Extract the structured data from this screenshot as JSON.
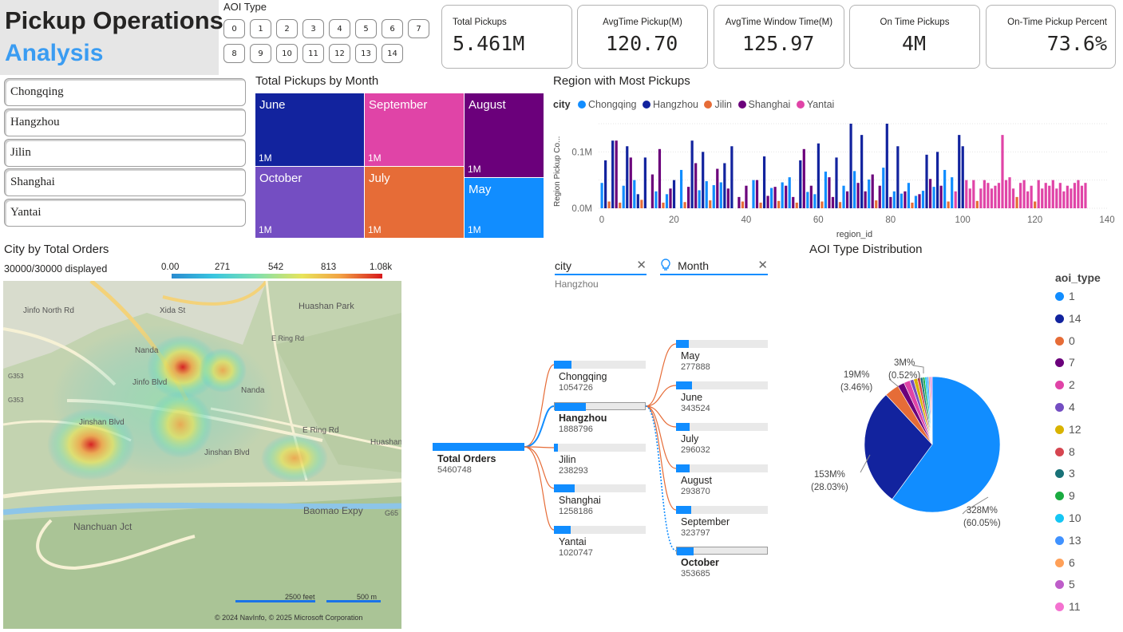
{
  "header": {
    "title_line1": "Pickup Operations",
    "title_line2": "Analysis"
  },
  "aoi_slicer": {
    "title": "AOI Type",
    "chips": [
      "0",
      "1",
      "2",
      "3",
      "4",
      "5",
      "6",
      "7",
      "8",
      "9",
      "10",
      "11",
      "12",
      "13",
      "14"
    ]
  },
  "kpis": [
    {
      "label": "Total Pickups",
      "value": "5.461M"
    },
    {
      "label": "AvgTime Pickup(M)",
      "value": "120.70"
    },
    {
      "label": "AvgTime Window Time(M)",
      "value": "125.97"
    },
    {
      "label": "On Time Pickups",
      "value": "4M"
    },
    {
      "label": "On-Time Pickup Percent",
      "value": "73.6%"
    }
  ],
  "city_slicer": [
    "Chongqing",
    "Hangzhou",
    "Jilin",
    "Shanghai",
    "Yantai"
  ],
  "treemap": {
    "title": "Total Pickups by Month",
    "cells": [
      {
        "name": "June",
        "value": "1M",
        "color": "#12239e"
      },
      {
        "name": "September",
        "value": "1M",
        "color": "#e044a7"
      },
      {
        "name": "August",
        "value": "1M",
        "color": "#6b007b"
      },
      {
        "name": "October",
        "value": "1M",
        "color": "#744ec2"
      },
      {
        "name": "July",
        "value": "1M",
        "color": "#e66c37"
      },
      {
        "name": "May",
        "value": "1M",
        "color": "#118dff"
      }
    ]
  },
  "chart_data": {
    "type": "bar",
    "title": "Region with Most Pickups",
    "xlabel": "region_id",
    "ylabel": "Region Pickup Co...",
    "legend_title": "city",
    "legend_position": "top-left",
    "xlim": [
      0,
      140
    ],
    "ylim": [
      0,
      0.15
    ],
    "xticks": [
      "0",
      "20",
      "40",
      "60",
      "80",
      "100",
      "120",
      "140"
    ],
    "yticks": [
      "0.0M",
      "0.1M"
    ],
    "grid": true,
    "series": [
      {
        "name": "Chongqing",
        "color": "#118dff",
        "points": [
          [
            0,
            0.045
          ],
          [
            6,
            0.04
          ],
          [
            9,
            0.05
          ],
          [
            15,
            0.03
          ],
          [
            18,
            0.025
          ],
          [
            22,
            0.068
          ],
          [
            27,
            0.032
          ],
          [
            29,
            0.048
          ],
          [
            31,
            0.041
          ],
          [
            33,
            0.046
          ],
          [
            42,
            0.05
          ],
          [
            47,
            0.036
          ],
          [
            50,
            0.046
          ],
          [
            52,
            0.055
          ],
          [
            57,
            0.029
          ],
          [
            59,
            0.025
          ],
          [
            62,
            0.065
          ],
          [
            67,
            0.04
          ],
          [
            70,
            0.066
          ],
          [
            72,
            0.048
          ],
          [
            74,
            0.051
          ],
          [
            78,
            0.072
          ],
          [
            81,
            0.03
          ],
          [
            83,
            0.026
          ],
          [
            85,
            0.045
          ],
          [
            87,
            0.022
          ],
          [
            89,
            0.031
          ],
          [
            92,
            0.038
          ],
          [
            95,
            0.068
          ],
          [
            97,
            0.055
          ]
        ]
      },
      {
        "name": "Hangzhou",
        "color": "#12239e",
        "points": [
          [
            1,
            0.085
          ],
          [
            3,
            0.12
          ],
          [
            7,
            0.11
          ],
          [
            10,
            0.025
          ],
          [
            12,
            0.09
          ],
          [
            20,
            0.05
          ],
          [
            25,
            0.12
          ],
          [
            28,
            0.1
          ],
          [
            34,
            0.08
          ],
          [
            36,
            0.11
          ],
          [
            45,
            0.092
          ],
          [
            55,
            0.085
          ],
          [
            60,
            0.115
          ],
          [
            65,
            0.09
          ],
          [
            69,
            0.15
          ],
          [
            72,
            0.13
          ],
          [
            79,
            0.15
          ],
          [
            82,
            0.11
          ],
          [
            90,
            0.095
          ],
          [
            93,
            0.1
          ],
          [
            99,
            0.13
          ],
          [
            100,
            0.11
          ]
        ]
      },
      {
        "name": "Jilin",
        "color": "#e66c37",
        "points": [
          [
            2,
            0.012
          ],
          [
            5,
            0.01
          ],
          [
            11,
            0.015
          ],
          [
            17,
            0.01
          ],
          [
            23,
            0.011
          ],
          [
            30,
            0.014
          ],
          [
            39,
            0.012
          ],
          [
            44,
            0.01
          ],
          [
            49,
            0.013
          ],
          [
            54,
            0.01
          ],
          [
            61,
            0.012
          ],
          [
            66,
            0.011
          ],
          [
            76,
            0.014
          ],
          [
            86,
            0.01
          ],
          [
            96,
            0.012
          ],
          [
            104,
            0.013
          ],
          [
            115,
            0.02
          ],
          [
            120,
            0.012
          ]
        ]
      },
      {
        "name": "Shanghai",
        "color": "#6b007b",
        "points": [
          [
            4,
            0.12
          ],
          [
            8,
            0.09
          ],
          [
            14,
            0.06
          ],
          [
            16,
            0.105
          ],
          [
            19,
            0.035
          ],
          [
            24,
            0.038
          ],
          [
            26,
            0.08
          ],
          [
            32,
            0.07
          ],
          [
            35,
            0.035
          ],
          [
            38,
            0.02
          ],
          [
            40,
            0.04
          ],
          [
            43,
            0.05
          ],
          [
            46,
            0.022
          ],
          [
            48,
            0.038
          ],
          [
            51,
            0.04
          ],
          [
            53,
            0.02
          ],
          [
            56,
            0.105
          ],
          [
            58,
            0.04
          ],
          [
            63,
            0.055
          ],
          [
            64,
            0.02
          ],
          [
            68,
            0.03
          ],
          [
            71,
            0.045
          ],
          [
            73,
            0.03
          ],
          [
            75,
            0.06
          ],
          [
            77,
            0.04
          ],
          [
            80,
            0.02
          ],
          [
            84,
            0.03
          ],
          [
            88,
            0.025
          ],
          [
            91,
            0.052
          ],
          [
            94,
            0.04
          ]
        ]
      },
      {
        "name": "Yantai",
        "color": "#e044a7",
        "points": [
          [
            98,
            0.03
          ],
          [
            101,
            0.05
          ],
          [
            102,
            0.035
          ],
          [
            103,
            0.05
          ],
          [
            105,
            0.035
          ],
          [
            106,
            0.05
          ],
          [
            107,
            0.045
          ],
          [
            108,
            0.035
          ],
          [
            109,
            0.04
          ],
          [
            110,
            0.045
          ],
          [
            111,
            0.13
          ],
          [
            112,
            0.05
          ],
          [
            113,
            0.055
          ],
          [
            114,
            0.035
          ],
          [
            116,
            0.045
          ],
          [
            117,
            0.05
          ],
          [
            118,
            0.03
          ],
          [
            119,
            0.04
          ],
          [
            121,
            0.05
          ],
          [
            122,
            0.035
          ],
          [
            123,
            0.045
          ],
          [
            124,
            0.04
          ],
          [
            125,
            0.05
          ],
          [
            126,
            0.035
          ],
          [
            127,
            0.045
          ],
          [
            128,
            0.03
          ],
          [
            129,
            0.04
          ],
          [
            130,
            0.035
          ],
          [
            131,
            0.045
          ],
          [
            132,
            0.05
          ],
          [
            133,
            0.04
          ],
          [
            134,
            0.045
          ]
        ]
      }
    ]
  },
  "map": {
    "title": "City by Total Orders",
    "displayed": "30000/30000 displayed",
    "scale_ticks": [
      "0.00",
      "271",
      "542",
      "813",
      "1.08k"
    ],
    "labels": [
      "Huashan Park",
      "Xida St",
      "Jinfo North Rd",
      "Nanda",
      "Jinfo Blvd",
      "Jinshan Blvd",
      "Jinshan Blvd",
      "E Ring Rd",
      "E Ring Rd",
      "Nanda",
      "Huashan M",
      "Baomao Expy",
      "Nanchuan Jct",
      "G353",
      "G353",
      "G65"
    ],
    "scale_feet": "2500 feet",
    "scale_m": "500 m",
    "copyright": "© 2024 NavInfo, © 2025 Microsoft Corporation"
  },
  "decomp": {
    "filters": [
      {
        "label": "city",
        "value": "Hangzhou"
      },
      {
        "label": "Month"
      }
    ],
    "root": {
      "name": "Total Orders",
      "value": "5460748"
    },
    "cities": [
      {
        "name": "Chongqing",
        "value": "1054726",
        "ratio": 0.56
      },
      {
        "name": "Hangzhou",
        "value": "1888796",
        "ratio": 1.0,
        "selected": true
      },
      {
        "name": "Jilin",
        "value": "238293",
        "ratio": 0.13
      },
      {
        "name": "Shanghai",
        "value": "1258186",
        "ratio": 0.67
      },
      {
        "name": "Yantai",
        "value": "1020747",
        "ratio": 0.54
      }
    ],
    "months": [
      {
        "name": "May",
        "value": "277888",
        "ratio": 0.79
      },
      {
        "name": "June",
        "value": "343524",
        "ratio": 0.97
      },
      {
        "name": "July",
        "value": "296032",
        "ratio": 0.84
      },
      {
        "name": "August",
        "value": "293870",
        "ratio": 0.83
      },
      {
        "name": "September",
        "value": "323797",
        "ratio": 0.92
      },
      {
        "name": "October",
        "value": "353685",
        "ratio": 1.0,
        "selected": true
      }
    ]
  },
  "pie": {
    "title": "AOI Type Distribution",
    "legend_title": "aoi_type",
    "slices": [
      {
        "label": "1",
        "percent": 60.05,
        "color": "#118dff"
      },
      {
        "label": "14",
        "percent": 28.03,
        "color": "#12239e"
      },
      {
        "label": "0",
        "percent": 3.46,
        "color": "#e66c37"
      },
      {
        "label": "7",
        "percent": 1.6,
        "color": "#6b007b"
      },
      {
        "label": "2",
        "percent": 1.5,
        "color": "#e044a7"
      },
      {
        "label": "4",
        "percent": 0.9,
        "color": "#744ec2"
      },
      {
        "label": "12",
        "percent": 0.9,
        "color": "#d9b300"
      },
      {
        "label": "8",
        "percent": 0.7,
        "color": "#d64550"
      },
      {
        "label": "3",
        "percent": 0.6,
        "color": "#197278"
      },
      {
        "label": "9",
        "percent": 0.5,
        "color": "#1aab40"
      },
      {
        "label": "10",
        "percent": 0.5,
        "color": "#15c6f4"
      },
      {
        "label": "13",
        "percent": 0.4,
        "color": "#4092ff"
      },
      {
        "label": "6",
        "percent": 0.3,
        "color": "#ffa058"
      },
      {
        "label": "5",
        "percent": 0.3,
        "color": "#be5dc9"
      },
      {
        "label": "11",
        "percent": 0.26,
        "color": "#f472d0"
      }
    ],
    "callouts": [
      {
        "value": "328M%",
        "pct": "(60.05%)"
      },
      {
        "value": "153M%",
        "pct": "(28.03%)"
      },
      {
        "value": "19M%",
        "pct": "(3.46%)"
      },
      {
        "value": "3M%",
        "pct": "(0.52%)"
      }
    ]
  }
}
